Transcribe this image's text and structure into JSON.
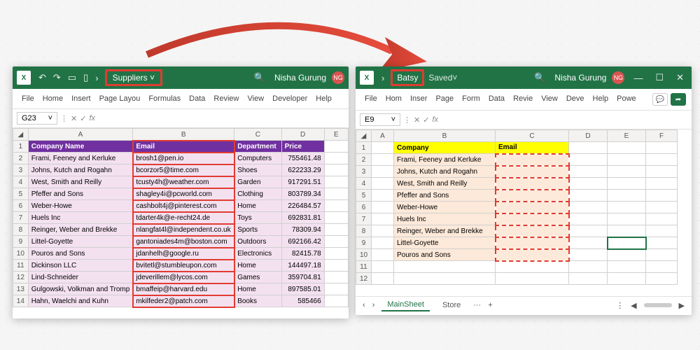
{
  "left": {
    "docname": "Suppliers",
    "username": "Nisha Gurung",
    "initials": "NG",
    "tabs": [
      "File",
      "Home",
      "Insert",
      "Page Layou",
      "Formulas",
      "Data",
      "Review",
      "View",
      "Developer",
      "Help"
    ],
    "namebox": "G23",
    "cols": [
      "A",
      "B",
      "C",
      "D",
      "E"
    ],
    "headers": [
      "Company Name",
      "Email",
      "Department",
      "Price"
    ],
    "rows": [
      [
        "Frami, Feeney and Kerluke",
        "brosh1@pen.io",
        "Computers",
        "755461.48"
      ],
      [
        "Johns, Kutch and Rogahn",
        "bcorzor5@time.com",
        "Shoes",
        "622233.29"
      ],
      [
        "West, Smith and Reilly",
        "tcusty4h@weather.com",
        "Garden",
        "917291.51"
      ],
      [
        "Pfeffer and Sons",
        "shagley4i@pcworld.com",
        "Clothing",
        "803789.34"
      ],
      [
        "Weber-Howe",
        "cashbolt4j@pinterest.com",
        "Home",
        "226484.57"
      ],
      [
        "Huels Inc",
        "tdarter4k@e-recht24.de",
        "Toys",
        "692831.81"
      ],
      [
        "Reinger, Weber and Brekke",
        "nlangfat4l@independent.co.uk",
        "Sports",
        "78309.94"
      ],
      [
        "Littel-Goyette",
        "gantoniades4m@boston.com",
        "Outdoors",
        "692166.42"
      ],
      [
        "Pouros and Sons",
        "jdanhelh@google.ru",
        "Electronics",
        "82415.78"
      ],
      [
        "Dickinson LLC",
        "bvitetl@stumbleupon.com",
        "Home",
        "144497.18"
      ],
      [
        "Lind-Schneider",
        "jdeverillem@lycos.com",
        "Games",
        "359704.81"
      ],
      [
        "Gulgowski, Volkman and Tromp",
        "bmaffeip@harvard.edu",
        "Home",
        "897585.01"
      ],
      [
        "Hahn, Waelchi and Kuhn",
        "mkilfeder2@patch.com",
        "Books",
        "585466"
      ]
    ]
  },
  "right": {
    "docname": "Batsy",
    "saved": "Saved",
    "username": "Nisha Gurung",
    "initials": "NG",
    "tabs": [
      "File",
      "Hom",
      "Inser",
      "Page",
      "Form",
      "Data",
      "Revie",
      "View",
      "Deve",
      "Help",
      "Powe"
    ],
    "namebox": "E9",
    "cols": [
      "A",
      "B",
      "C",
      "D",
      "E",
      "F"
    ],
    "headers": [
      "Company",
      "Email"
    ],
    "rows": [
      "Frami, Feeney and Kerluke",
      "Johns, Kutch and Rogahn",
      "West, Smith and Reilly",
      "Pfeffer and Sons",
      "Weber-Howe",
      "Huels Inc",
      "Reinger, Weber and Brekke",
      "Littel-Goyette",
      "Pouros and Sons"
    ],
    "sheets": [
      "MainSheet",
      "Store"
    ]
  }
}
